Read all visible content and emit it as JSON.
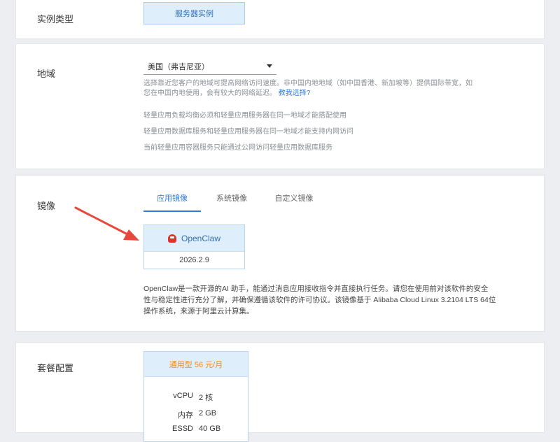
{
  "instance_type": {
    "label": "实例类型",
    "option": "服务器实例"
  },
  "region": {
    "label": "地域",
    "selected": "美国（弗吉尼亚）",
    "hint_1a": "选择靠近您客户的地域可提高网络访问速度。非中国内地地域（如中国香港、新加坡等）提供国际带宽，如",
    "hint_1b": "您在中国内地使用，会有较大的网络延迟。",
    "help_link": "教我选择?",
    "hint_2": "轻量应用负载均衡必须和轻量应用服务器在同一地域才能搭配使用",
    "hint_3": "轻量应用数据库服务和轻量应用服务器在同一地域才能支持内网访问",
    "hint_4": "当前轻量应用容器服务只能通过公网访问轻量应用数据库服务"
  },
  "image": {
    "label": "镜像",
    "tabs": [
      "应用镜像",
      "系统镜像",
      "自定义镜像"
    ],
    "card": {
      "name": "OpenClaw",
      "version": "2026.2.9"
    },
    "desc_1": "OpenClaw是一款开源的AI 助手，能通过消息应用接收指令并直接执行任务。请您在使用前对该软件的安全",
    "desc_2": "性与稳定性进行充分了解，并确保遵循该软件的许可协议。该镜像基于 Alibaba Cloud Linux 3.2104 LTS 64位",
    "desc_3": "操作系统，来源于阿里云计算集。"
  },
  "package": {
    "label": "套餐配置",
    "name": "通用型 56 元/月",
    "specs": [
      {
        "key": "vCPU",
        "value": "2 核"
      },
      {
        "key": "内存",
        "value": "2 GB"
      },
      {
        "key": "ESSD",
        "value": "40 GB"
      }
    ]
  },
  "colors": {
    "accent": "#2f7bd8",
    "card_bg": "#dfeefb",
    "price": "#ef8a1f",
    "annotation_arrow": "#e8473c"
  }
}
